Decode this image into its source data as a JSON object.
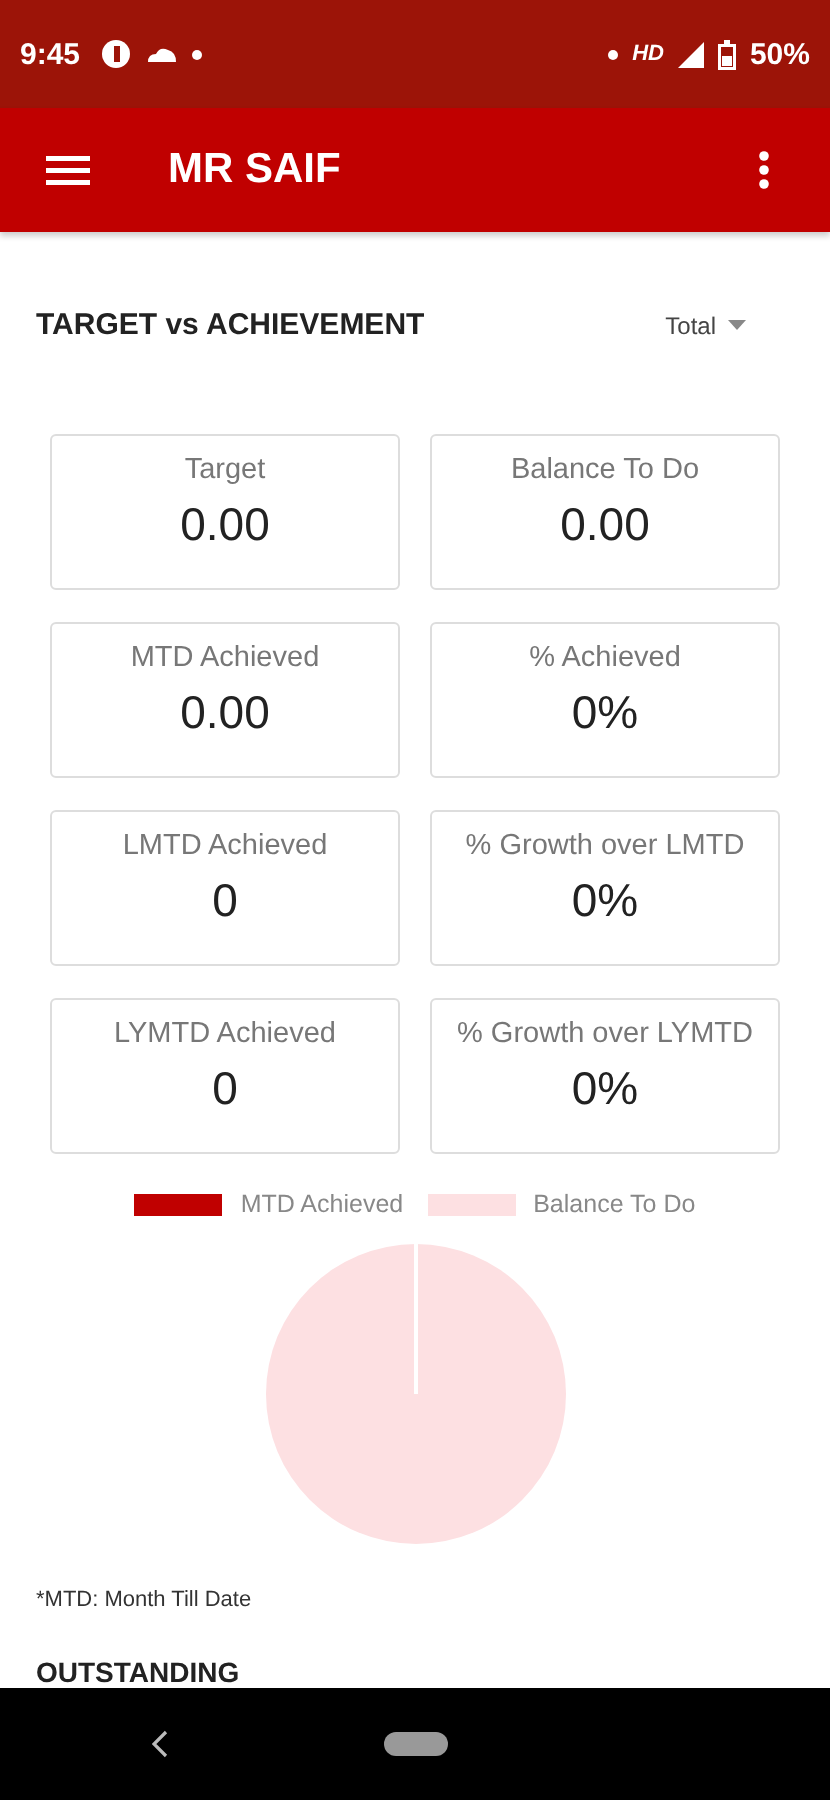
{
  "status_bar": {
    "time": "9:45",
    "battery": "50%",
    "network": "HD"
  },
  "app_bar": {
    "title": "MR SAIF"
  },
  "section": {
    "title": "TARGET vs ACHIEVEMENT",
    "filter": "Total"
  },
  "cards": [
    {
      "label": "Target",
      "value": "0.00"
    },
    {
      "label": "Balance To Do",
      "value": "0.00"
    },
    {
      "label": "MTD Achieved",
      "value": "0.00"
    },
    {
      "label": "% Achieved",
      "value": "0%"
    },
    {
      "label": "LMTD Achieved",
      "value": "0"
    },
    {
      "label": "% Growth over LMTD",
      "value": "0%"
    },
    {
      "label": "LYMTD Achieved",
      "value": "0"
    },
    {
      "label": "% Growth over LYMTD",
      "value": "0%"
    }
  ],
  "legend": [
    {
      "label": "MTD Achieved",
      "color": "#c00000"
    },
    {
      "label": "Balance To Do",
      "color": "#fde0e2"
    }
  ],
  "footnote": "*MTD: Month Till Date",
  "next_section": {
    "title": "OUTSTANDING"
  }
}
